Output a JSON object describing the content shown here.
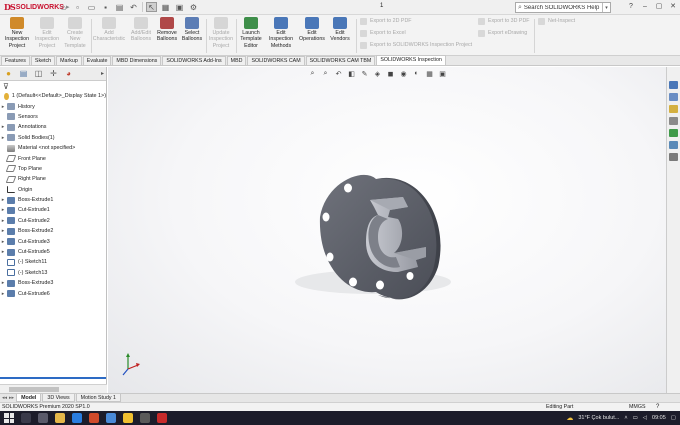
{
  "app": {
    "title": "1",
    "logo_brand": "DS",
    "logo_text": "SOLIDWORKS"
  },
  "search": {
    "placeholder": "Search SOLIDWORKS Help"
  },
  "ribbon": {
    "buttons": [
      {
        "label1": "New",
        "label2": "Inspection",
        "label3": "Project",
        "enabled": true,
        "color": "#d08a2a"
      },
      {
        "label1": "Edit",
        "label2": "Inspection",
        "label3": "Project",
        "enabled": false
      },
      {
        "label1": "Create",
        "label2": "New",
        "label3": "Template",
        "enabled": false
      },
      {
        "label1": "Add",
        "label2": "Characteristic",
        "label3": "",
        "enabled": false
      },
      {
        "label1": "Add/Edit",
        "label2": "Balloons",
        "label3": "",
        "enabled": false
      },
      {
        "label1": "Remove",
        "label2": "Balloons",
        "label3": "",
        "enabled": true,
        "color": "#b04848"
      },
      {
        "label1": "Select",
        "label2": "Balloons",
        "label3": "",
        "enabled": true,
        "color": "#5c7db5"
      },
      {
        "label1": "Update",
        "label2": "Inspection",
        "label3": "Project",
        "enabled": false
      },
      {
        "label1": "Launch",
        "label2": "Template",
        "label3": "Editor",
        "enabled": true,
        "color": "#3f8f4a"
      },
      {
        "label1": "Edit",
        "label2": "Inspection",
        "label3": "Methods",
        "enabled": true,
        "color": "#4a77b8"
      },
      {
        "label1": "Edit",
        "label2": "Operations",
        "label3": "",
        "enabled": true,
        "color": "#4a77b8"
      },
      {
        "label1": "Edit",
        "label2": "Vendors",
        "label3": "",
        "enabled": true,
        "color": "#4a77b8"
      }
    ],
    "export_list_1": [
      "Export to 2D PDF",
      "Export to Excel",
      "Export to SOLIDWORKS Inspection Project"
    ],
    "export_list_2": [
      "Export to 3D PDF",
      "Export eDrawing"
    ],
    "export_list_3": [
      "Net-Inspect"
    ]
  },
  "tabs": [
    "Features",
    "Sketch",
    "Markup",
    "Evaluate",
    "MBD Dimensions",
    "SOLIDWORKS Add-Ins",
    "MBD",
    "SOLIDWORKS CAM",
    "SOLIDWORKS CAM TBM",
    "SOLIDWORKS Inspection"
  ],
  "tree": {
    "root": "1 (Default<<Default>_Display State 1>)",
    "items": [
      {
        "label": "History",
        "icon": "folder",
        "expand": true
      },
      {
        "label": "Sensors",
        "icon": "folder",
        "expand": false
      },
      {
        "label": "Annotations",
        "icon": "folder",
        "expand": true
      },
      {
        "label": "Solid Bodies(1)",
        "icon": "folder",
        "expand": true
      },
      {
        "label": "Material <not specified>",
        "icon": "mat",
        "expand": false
      },
      {
        "label": "Front Plane",
        "icon": "plane",
        "expand": false
      },
      {
        "label": "Top Plane",
        "icon": "plane",
        "expand": false
      },
      {
        "label": "Right Plane",
        "icon": "plane",
        "expand": false
      },
      {
        "label": "Origin",
        "icon": "origin",
        "expand": false
      },
      {
        "label": "Boss-Extrude1",
        "icon": "feat",
        "expand": true
      },
      {
        "label": "Cut-Extrude1",
        "icon": "feat",
        "expand": true
      },
      {
        "label": "Cut-Extrude2",
        "icon": "feat",
        "expand": true
      },
      {
        "label": "Boss-Extrude2",
        "icon": "feat",
        "expand": true
      },
      {
        "label": "Cut-Extrude3",
        "icon": "feat",
        "expand": true
      },
      {
        "label": "Cut-Extrude5",
        "icon": "feat",
        "expand": true
      },
      {
        "label": "(-) Sketch11",
        "icon": "sketch",
        "expand": false
      },
      {
        "label": "(-) Sketch13",
        "icon": "sketch",
        "expand": false
      },
      {
        "label": "Boss-Extrude3",
        "icon": "feat",
        "expand": true
      },
      {
        "label": "Cut-Extrude6",
        "icon": "feat",
        "expand": true
      }
    ]
  },
  "bottom_tabs": [
    "Model",
    "3D Views",
    "Motion Study 1"
  ],
  "status": {
    "version": "SOLIDWORKS Premium 2020 SP1.0",
    "mode": "Editing Part",
    "units": "MMGS",
    "help": "?"
  },
  "taskbar": {
    "weather": "31°F  Çok bulut...",
    "time": "09:05"
  },
  "colors": {
    "accent": "#c8102e",
    "part": "#5a5d66",
    "selection": "#2d6bc4"
  }
}
